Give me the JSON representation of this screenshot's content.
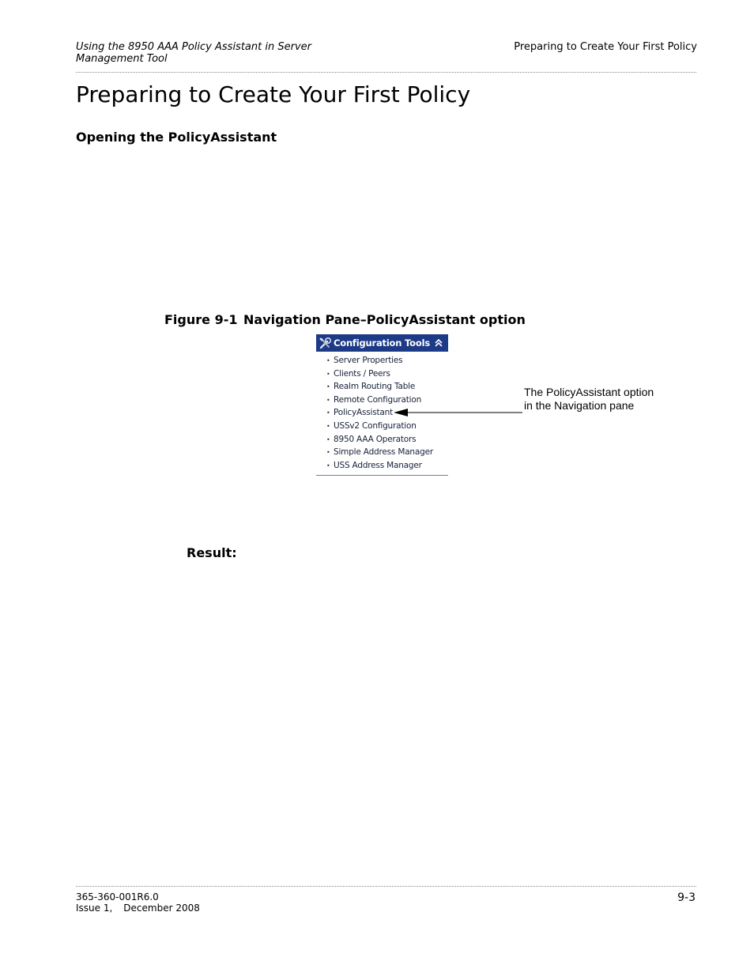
{
  "header": {
    "left_line1": "Using the 8950 AAA Policy Assistant in Server",
    "left_line2": "Management Tool",
    "right": "Preparing to Create Your First Policy"
  },
  "title": "Preparing to Create Your First Policy",
  "section_heading": "Opening the PolicyAssistant",
  "figure": {
    "number": "Figure 9-1",
    "caption": "Navigation Pane–PolicyAssistant option",
    "pane": {
      "header_label": "Configuration Tools",
      "header_icon": "tools-icon",
      "collapse_icon": "double-chevron-up-icon",
      "bullet": "•",
      "items": [
        {
          "label": "Server Properties"
        },
        {
          "label": "Clients / Peers"
        },
        {
          "label": "Realm Routing Table"
        },
        {
          "label": "Remote Configuration"
        },
        {
          "label": "PolicyAssistant"
        },
        {
          "label": "USSv2 Configuration"
        },
        {
          "label": "8950 AAA Operators"
        },
        {
          "label": "Simple Address Manager"
        },
        {
          "label": "USS Address Manager"
        }
      ],
      "colors": {
        "header_bg": "#1c3a86",
        "header_text": "#ffffff"
      }
    },
    "callout_line1": "The PolicyAssistant option",
    "callout_line2": "in the Navigation pane"
  },
  "result_label": "Result:",
  "footer": {
    "doc_number": "365-360-001R6.0",
    "issue": "Issue 1,",
    "date": "December 2008",
    "page": "9-3"
  }
}
